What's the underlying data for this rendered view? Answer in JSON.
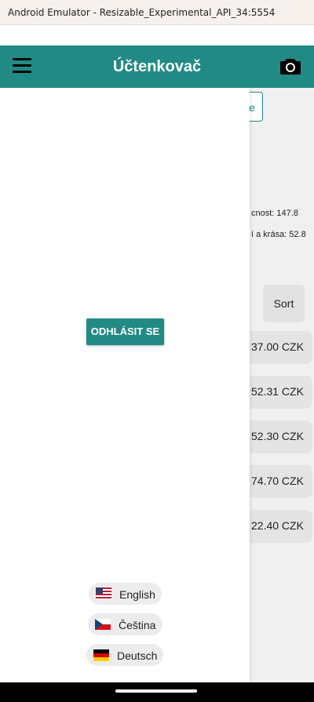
{
  "window": {
    "title": "Android Emulator - Resizable_Experimental_API_34:5554"
  },
  "app_bar": {
    "title": "Účtenkovač",
    "menu_icon": "menu-icon",
    "camera_icon": "camera-icon"
  },
  "background": {
    "button_fragment": "e",
    "stats": [
      "cnost: 147.8",
      "í a krása: 52.8"
    ],
    "sort_label": "Sort",
    "amounts": [
      "37.00 CZK",
      "52.31 CZK",
      "52.30 CZK",
      "74.70 CZK",
      "22.40 CZK"
    ]
  },
  "drawer": {
    "logout_label": "ODHLÁSIT SE",
    "languages": [
      {
        "label": "English",
        "flag": "flag-us-icon"
      },
      {
        "label": "Čeština",
        "flag": "flag-cz-icon"
      },
      {
        "label": "Deutsch",
        "flag": "flag-de-icon"
      }
    ]
  },
  "colors": {
    "primary": "#218a85",
    "drawer_bg": "#ffffff",
    "content_bg": "#f0f0f0"
  }
}
